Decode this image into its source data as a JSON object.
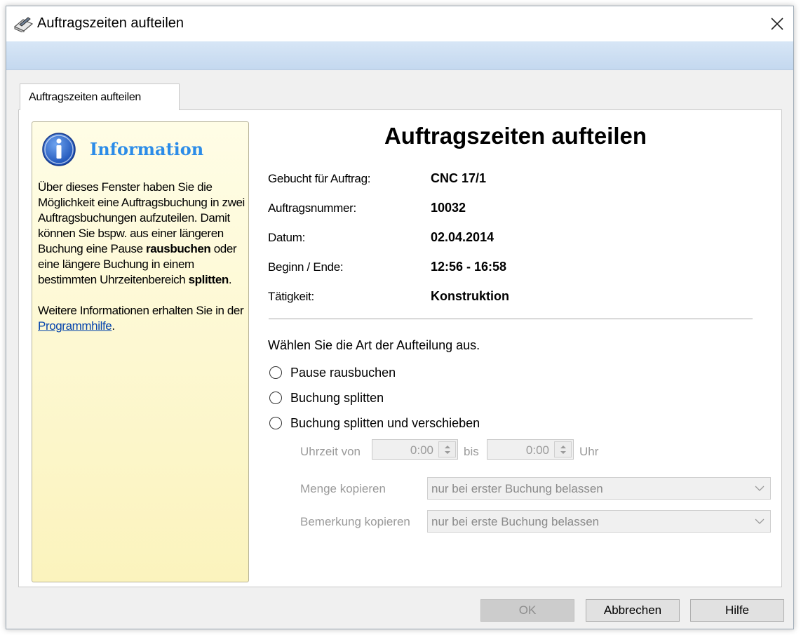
{
  "window": {
    "title": "Auftragszeiten aufteilen",
    "close_glyph": "✕"
  },
  "tab": {
    "label": "Auftragszeiten aufteilen"
  },
  "info": {
    "title": "Information",
    "text_1": "Über dieses Fenster haben Sie die Möglichkeit eine Auftragsbuchung in zwei Auftragsbuchungen aufzuteilen. Damit können Sie bspw. aus einer längeren Buchung eine Pause ",
    "bold_1": "rausbuchen",
    "text_2": " oder eine längere Buchung in einem bestimmten Uhrzeitenbereich ",
    "bold_2": "splitten",
    "text_3": ".",
    "text_4": "Weitere Informationen erhalten Sie in der ",
    "link": "Programmhilfe",
    "text_5": "."
  },
  "main": {
    "title": "Auftragszeiten aufteilen",
    "fields": [
      {
        "label": "Gebucht für Auftrag:",
        "value": "CNC 17/1"
      },
      {
        "label": "Auftragsnummer:",
        "value": "10032"
      },
      {
        "label": "Datum:",
        "value": "02.04.2014"
      },
      {
        "label": "Beginn / Ende:",
        "value": "12:56 - 16:58"
      },
      {
        "label": "Tätigkeit:",
        "value": "Konstruktion"
      }
    ],
    "choose_label": "Wählen Sie die Art der Aufteilung aus.",
    "options": [
      "Pause rausbuchen",
      "Buchung splitten",
      "Buchung splitten und verschieben"
    ],
    "time": {
      "from_label": "Uhrzeit von",
      "from_value": "0:00",
      "to_label": "bis",
      "to_value": "0:00",
      "unit": "Uhr"
    },
    "menge": {
      "label": "Menge kopieren",
      "value": "nur bei erster Buchung belassen"
    },
    "bemerkung": {
      "label": "Bemerkung kopieren",
      "value": "nur bei erste Buchung belassen"
    }
  },
  "buttons": {
    "ok": "OK",
    "cancel": "Abbrechen",
    "help": "Hilfe"
  },
  "colors": {
    "info_title": "#2c8ce8",
    "info_bg": "#fbf3bd",
    "ribbon": "#c4d8ef",
    "link": "#0645ad"
  },
  "icons": {
    "title": "book-pencil-icon",
    "info": "info-circle-icon",
    "close": "close-icon",
    "spin": "spin-arrows-icon",
    "combo": "chevron-down-icon"
  }
}
